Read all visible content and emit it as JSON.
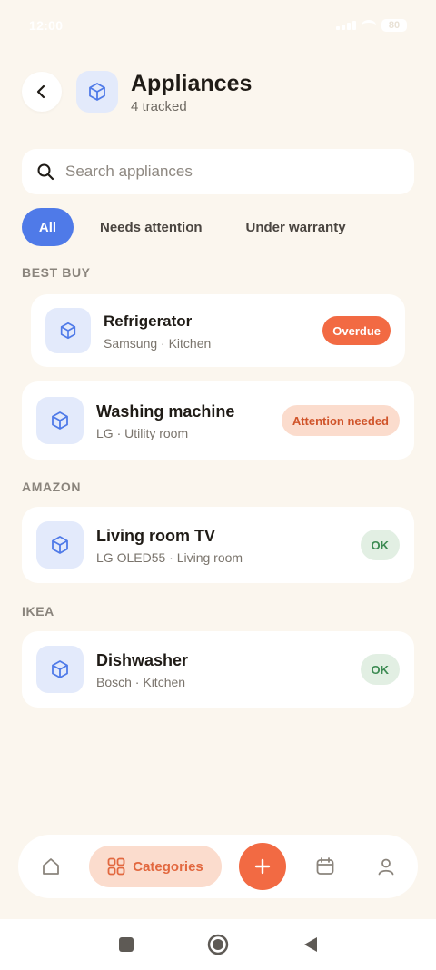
{
  "status_bar": {
    "time": "12:00",
    "battery": "80"
  },
  "header": {
    "title": "Appliances",
    "subtitle": "4 tracked"
  },
  "search": {
    "placeholder": "Search appliances",
    "value": ""
  },
  "filters": [
    {
      "label": "All",
      "active": true
    },
    {
      "label": "Needs attention",
      "active": false
    },
    {
      "label": "Under warranty",
      "active": false
    }
  ],
  "sections": [
    {
      "title": "BEST BUY",
      "items": [
        {
          "name": "Refrigerator",
          "meta": "Samsung · Kitchen",
          "status": "Overdue",
          "status_type": "overdue"
        },
        {
          "name": "Washing machine",
          "meta": "LG · Utility room",
          "status": "Attention needed",
          "status_type": "attention"
        }
      ]
    },
    {
      "title": "AMAZON",
      "items": [
        {
          "name": "Living room TV",
          "meta": "LG OLED55 · Living room",
          "status": "OK",
          "status_type": "ok"
        }
      ]
    },
    {
      "title": "IKEA",
      "items": [
        {
          "name": "Dishwasher",
          "meta": "Bosch · Kitchen",
          "status": "OK",
          "status_type": "ok"
        }
      ]
    }
  ],
  "bottom_nav": {
    "home_icon": "home-icon",
    "categories_label": "Categories",
    "add_icon": "plus-icon",
    "calendar_icon": "calendar-icon",
    "profile_icon": "person-icon"
  },
  "colors": {
    "background": "#FBF6EE",
    "accent_blue": "#4F7AE8",
    "accent_orange": "#F26A43",
    "ok_green": "#3D8B53"
  }
}
